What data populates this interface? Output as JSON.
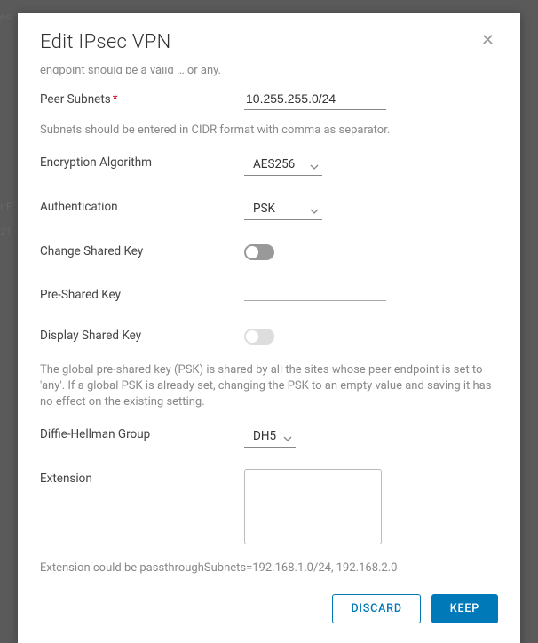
{
  "modal": {
    "title": "Edit IPsec VPN"
  },
  "form": {
    "cutoff_hint": "endpoint should be a valid … or any.",
    "peer_subnets": {
      "label": "Peer Subnets",
      "value": "10.255.255.0/24",
      "helper": "Subnets should be entered in CIDR format with comma as separator."
    },
    "encryption": {
      "label": "Encryption Algorithm",
      "value": "AES256"
    },
    "authentication": {
      "label": "Authentication",
      "value": "PSK"
    },
    "change_shared_key": {
      "label": "Change Shared Key",
      "value": false
    },
    "pre_shared_key": {
      "label": "Pre-Shared Key",
      "value": ""
    },
    "display_shared_key": {
      "label": "Display Shared Key",
      "value": false
    },
    "psk_helper": "The global pre-shared key (PSK) is shared by all the sites whose peer endpoint is set to 'any'. If a global PSK is already set, changing the PSK to an empty value and saving it has no effect on the existing setting.",
    "dh_group": {
      "label": "Diffie-Hellman Group",
      "value": "DH5"
    },
    "extension": {
      "label": "Extension",
      "value": "",
      "helper": "Extension could be passthroughSubnets=192.168.1.0/24, 192.168.2.0"
    }
  },
  "footer": {
    "discard": "DISCARD",
    "keep": "KEEP"
  },
  "background": {
    "partial1": "es",
    "partial2": "r F",
    "partial3": "21"
  }
}
